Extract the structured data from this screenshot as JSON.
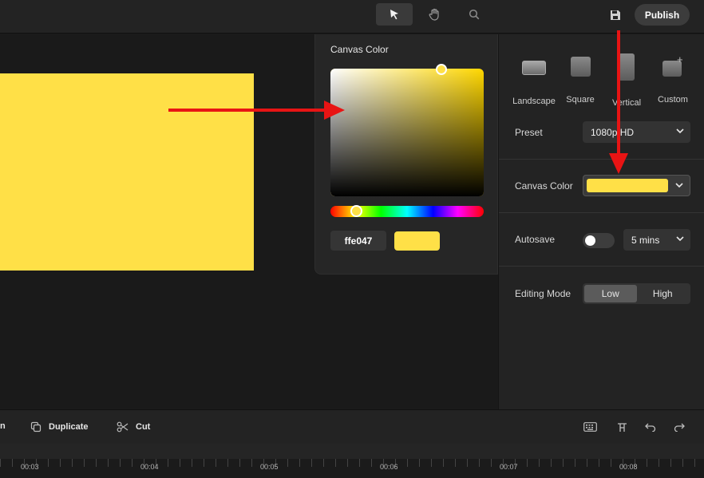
{
  "toolbar": {
    "tools": [
      {
        "name": "select-tool",
        "icon": "cursor-icon",
        "active": true
      },
      {
        "name": "pan-tool",
        "icon": "hand-icon",
        "active": false
      },
      {
        "name": "zoom-tool",
        "icon": "search-icon",
        "active": false
      }
    ],
    "save_icon": "save-icon",
    "publish_label": "Publish"
  },
  "canvas": {
    "background": "#ffe047"
  },
  "color_picker": {
    "title": "Canvas Color",
    "hex_value": "ffe047",
    "swatch_color": "#ffe047",
    "hue_color": "#ffd700"
  },
  "settings": {
    "orientations": [
      {
        "label": "Landscape",
        "icon": "landscape-icon"
      },
      {
        "label": "Square",
        "icon": "square-icon"
      },
      {
        "label": "Vertical",
        "icon": "vertical-icon"
      },
      {
        "label": "Custom",
        "icon": "custom-plus-icon"
      }
    ],
    "preset_label": "Preset",
    "preset_value": "1080p HD",
    "canvas_color_label": "Canvas Color",
    "canvas_color_value": "#ffe047",
    "autosave_label": "Autosave",
    "autosave_on": false,
    "autosave_interval": "5 mins",
    "editing_mode_label": "Editing Mode",
    "editing_modes": [
      "Low",
      "High"
    ],
    "editing_mode_selected": "Low"
  },
  "bottom_toolbar": {
    "partial_label": "n",
    "duplicate_label": "Duplicate",
    "cut_label": "Cut",
    "right_icons": [
      "keyboard-icon",
      "split-icon",
      "undo-icon",
      "redo-icon"
    ]
  },
  "timeline": {
    "ticks": [
      "00:03",
      "00:04",
      "00:05",
      "00:06",
      "00:07",
      "00:08"
    ]
  },
  "annotation_color": "#e81414"
}
